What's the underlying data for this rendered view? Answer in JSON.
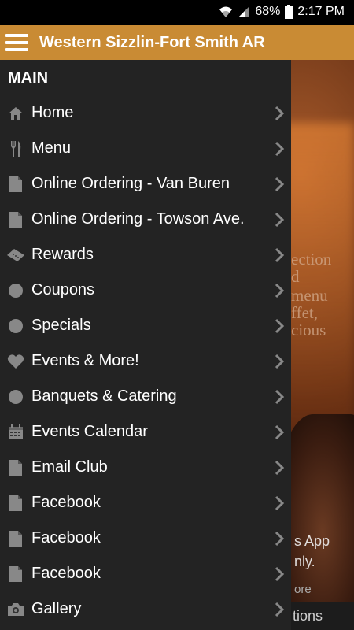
{
  "status_bar": {
    "battery": "68%",
    "time": "2:17 PM"
  },
  "app_bar": {
    "title": "Western Sizzlin-Fort Smith AR"
  },
  "drawer": {
    "section_title": "MAIN",
    "items": [
      {
        "label": "Home",
        "icon": "home-icon"
      },
      {
        "label": "Menu",
        "icon": "fork-knife-icon"
      },
      {
        "label": "Online Ordering - Van Buren",
        "icon": "document-icon"
      },
      {
        "label": "Online Ordering - Towson Ave.",
        "icon": "document-icon"
      },
      {
        "label": "Rewards",
        "icon": "ticket-icon"
      },
      {
        "label": "Coupons",
        "icon": "circle-icon"
      },
      {
        "label": "Specials",
        "icon": "circle-icon"
      },
      {
        "label": "Events & More!",
        "icon": "heart-icon"
      },
      {
        "label": "Banquets & Catering",
        "icon": "circle-icon"
      },
      {
        "label": "Events Calendar",
        "icon": "calendar-icon"
      },
      {
        "label": "Email Club",
        "icon": "document-icon"
      },
      {
        "label": "Facebook",
        "icon": "document-icon"
      },
      {
        "label": "Facebook",
        "icon": "document-icon"
      },
      {
        "label": "Facebook",
        "icon": "document-icon"
      },
      {
        "label": "Gallery",
        "icon": "camera-icon"
      }
    ]
  },
  "background": {
    "text_fragments": [
      "ection",
      "d",
      "menu",
      "ffet,",
      "cious"
    ],
    "overlay_lines": [
      "s App",
      "nly.",
      "ore"
    ],
    "bottom_label": "tions"
  },
  "colors": {
    "app_bar": "#c98b34",
    "drawer": "#232323",
    "icon": "#888888"
  }
}
